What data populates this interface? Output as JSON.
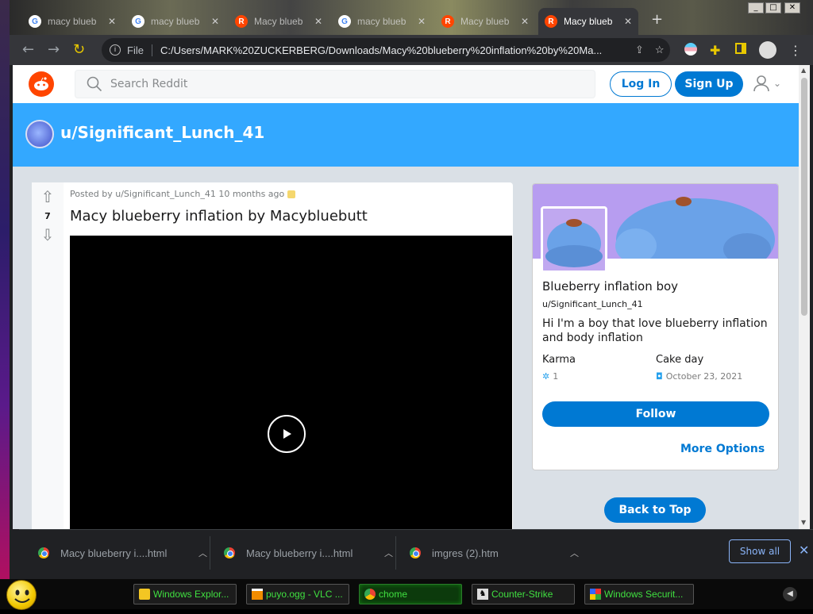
{
  "browser": {
    "tabs": [
      {
        "title": "macy blueb",
        "favicon": "G"
      },
      {
        "title": "macy blueb",
        "favicon": "G"
      },
      {
        "title": "Macy blueb",
        "favicon": "R"
      },
      {
        "title": "macy blueb",
        "favicon": "G"
      },
      {
        "title": "Macy blueb",
        "favicon": "R"
      },
      {
        "title": "Macy blueb",
        "favicon": "R"
      }
    ],
    "new_tab": "+",
    "close_tab": "✕",
    "window_buttons": [
      "_",
      "□",
      "✕"
    ],
    "omnibox": {
      "scheme_label": "File",
      "url": "C:/Users/MARK%20ZUCKERBERG/Downloads/Macy%20blueberry%20inflation%20by%20Ma..."
    }
  },
  "reddit": {
    "search_placeholder": "Search Reddit",
    "login_label": "Log In",
    "signup_label": "Sign Up",
    "profile_title": "u/Significant_Lunch_41",
    "post": {
      "meta": "Posted by u/Significant_Lunch_41 10 months ago",
      "votes": "7",
      "title": "Macy blueberry inflation by Macybluebutt"
    },
    "sidebar": {
      "display_name": "Blueberry inflation boy",
      "username": "u/Significant_Lunch_41",
      "bio": "Hi I'm a boy that love blueberry inflation and body inflation",
      "karma_label": "Karma",
      "karma_value": "1",
      "cakeday_label": "Cake day",
      "cakeday_value": "October 23, 2021",
      "follow_label": "Follow",
      "more_options_label": "More Options"
    },
    "back_to_top_label": "Back to Top"
  },
  "downloads": {
    "items": [
      {
        "name": "Macy blueberry i....html"
      },
      {
        "name": "Macy blueberry i....html"
      },
      {
        "name": "imgres (2).htm"
      }
    ],
    "show_all_label": "Show all",
    "close": "✕"
  },
  "taskbar": {
    "items": [
      {
        "label": "Windows Explor..."
      },
      {
        "label": "puyo.ogg - VLC ..."
      },
      {
        "label": "chome"
      },
      {
        "label": "Counter-Strike"
      },
      {
        "label": "Windows Securit..."
      }
    ]
  },
  "colors": {
    "reddit_orange": "#ff4500",
    "reddit_blue": "#0079d3",
    "profile_banner": "#33a8ff",
    "page_bg": "#dae0e6",
    "taskbar_text": "#40e040"
  }
}
